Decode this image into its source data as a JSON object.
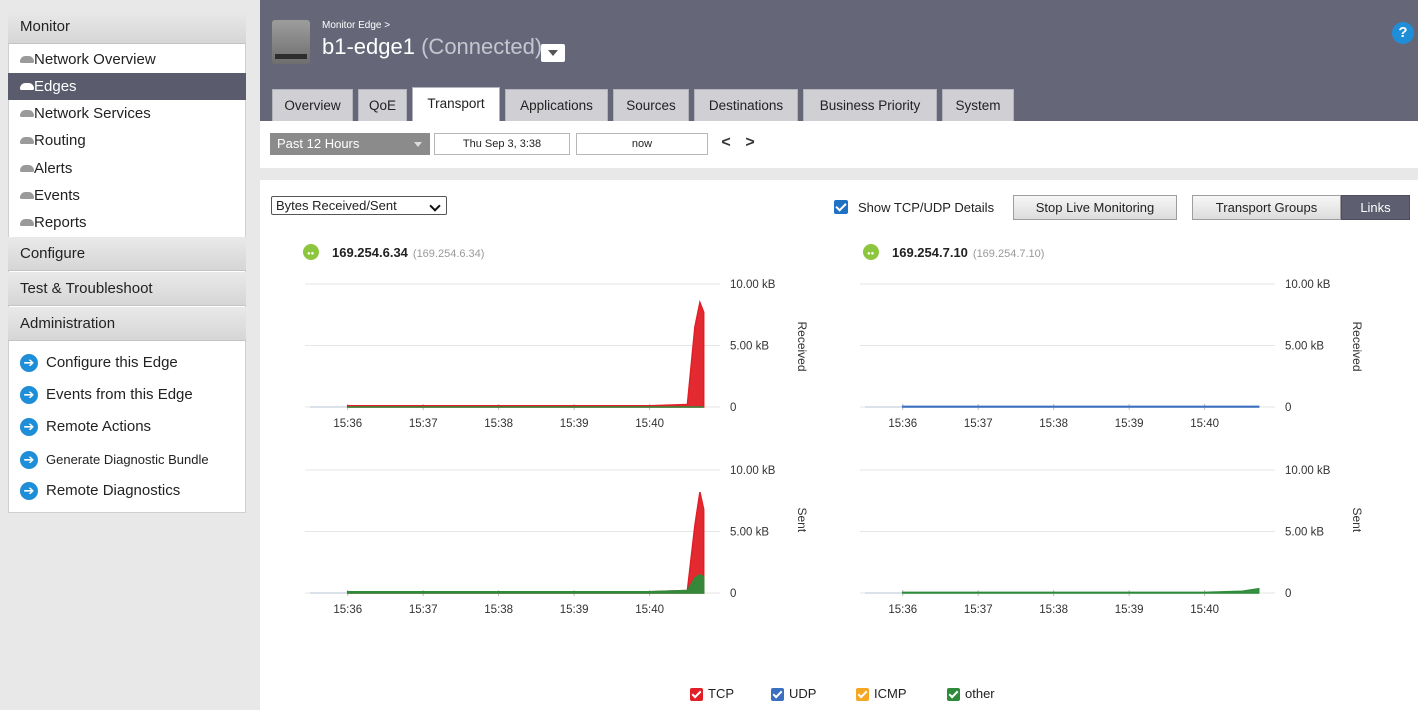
{
  "sidebar": {
    "sections": {
      "monitor": "Monitor",
      "configure": "Configure",
      "test": "Test & Troubleshoot",
      "administration": "Administration"
    },
    "monitor_items": [
      {
        "label": "Network Overview",
        "active": false
      },
      {
        "label": "Edges",
        "active": true
      },
      {
        "label": "Network Services",
        "active": false
      },
      {
        "label": "Routing",
        "active": false
      },
      {
        "label": "Alerts",
        "active": false
      },
      {
        "label": "Events",
        "active": false
      },
      {
        "label": "Reports",
        "active": false
      }
    ],
    "admin_actions": [
      "Configure this Edge",
      "Events from this Edge",
      "Remote Actions",
      "Generate Diagnostic Bundle",
      "Remote Diagnostics"
    ]
  },
  "header": {
    "breadcrumb": "Monitor Edge >",
    "edge_name": "b1-edge1",
    "status": "(Connected)",
    "help": "?"
  },
  "tabs": [
    {
      "label": "Overview",
      "active": false
    },
    {
      "label": "QoE",
      "active": false
    },
    {
      "label": "Transport",
      "active": true
    },
    {
      "label": "Applications",
      "active": false
    },
    {
      "label": "Sources",
      "active": false
    },
    {
      "label": "Destinations",
      "active": false
    },
    {
      "label": "Business Priority",
      "active": false
    },
    {
      "label": "System",
      "active": false
    }
  ],
  "timebar": {
    "range": "Past 12 Hours",
    "start": "Thu Sep 3, 3:38",
    "end": "now",
    "prev": "<",
    "next": ">"
  },
  "controls": {
    "metric": "Bytes Received/Sent",
    "show_tcp_udp_label": "Show TCP/UDP Details",
    "show_tcp_udp_checked": true,
    "stop_live_label": "Stop Live Monitoring",
    "transport_groups_label": "Transport Groups",
    "links_label": "Links"
  },
  "links": [
    {
      "ip": "169.254.6.34",
      "ip_paren": "(169.254.6.34)"
    },
    {
      "ip": "169.254.7.10",
      "ip_paren": "(169.254.7.10)"
    }
  ],
  "colors": {
    "tcp": "#e21f26",
    "udp": "#3b6fbf",
    "icmp": "#f5a623",
    "other": "#2e8b3a",
    "link_icon": "#8cc63f",
    "accent_blue": "#1f8ed8"
  },
  "legend": [
    "TCP",
    "UDP",
    "ICMP",
    "other"
  ],
  "chart_data": [
    {
      "type": "area",
      "link": "169.254.6.34",
      "panel": "Received",
      "x": [
        "15:36",
        "15:37",
        "15:38",
        "15:39",
        "15:40",
        "15:40:30",
        "15:40:36",
        "15:40:40",
        "15:40:43"
      ],
      "series": [
        {
          "name": "TCP",
          "values": [
            0.1,
            0.1,
            0.1,
            0.1,
            0.1,
            0.2,
            6.5,
            8.5,
            7.7
          ]
        },
        {
          "name": "other",
          "values": [
            0,
            0,
            0,
            0,
            0,
            0,
            0,
            0,
            0
          ]
        }
      ],
      "xticks": [
        "15:36",
        "15:37",
        "15:38",
        "15:39",
        "15:40"
      ],
      "yticks": [
        "0",
        "5.00 kB",
        "10.00 kB"
      ],
      "ylim": [
        0,
        10
      ],
      "ylabel": "Received"
    },
    {
      "type": "area",
      "link": "169.254.6.34",
      "panel": "Sent",
      "x": [
        "15:36",
        "15:37",
        "15:38",
        "15:39",
        "15:40",
        "15:40:30",
        "15:40:36",
        "15:40:40",
        "15:40:43"
      ],
      "series": [
        {
          "name": "TCP",
          "values": [
            0.1,
            0.1,
            0.1,
            0.1,
            0.1,
            0.2,
            5.5,
            8.2,
            6.8
          ]
        },
        {
          "name": "other",
          "values": [
            0.1,
            0.1,
            0.1,
            0.1,
            0.1,
            0.2,
            1.2,
            1.5,
            1.3
          ]
        }
      ],
      "xticks": [
        "15:36",
        "15:37",
        "15:38",
        "15:39",
        "15:40"
      ],
      "yticks": [
        "0",
        "5.00 kB",
        "10.00 kB"
      ],
      "ylim": [
        0,
        10
      ],
      "ylabel": "Sent"
    },
    {
      "type": "area",
      "link": "169.254.7.10",
      "panel": "Received",
      "x": [
        "15:36",
        "15:37",
        "15:38",
        "15:39",
        "15:40",
        "15:40:43"
      ],
      "series": [
        {
          "name": "UDP",
          "values": [
            0.05,
            0.05,
            0.05,
            0.05,
            0.05,
            0.05
          ]
        }
      ],
      "xticks": [
        "15:36",
        "15:37",
        "15:38",
        "15:39",
        "15:40"
      ],
      "yticks": [
        "0",
        "5.00 kB",
        "10.00 kB"
      ],
      "ylim": [
        0,
        10
      ],
      "ylabel": "Received"
    },
    {
      "type": "area",
      "link": "169.254.7.10",
      "panel": "Sent",
      "x": [
        "15:36",
        "15:37",
        "15:38",
        "15:39",
        "15:40",
        "15:40:30",
        "15:40:43"
      ],
      "series": [
        {
          "name": "other",
          "values": [
            0.05,
            0.05,
            0.05,
            0.05,
            0.05,
            0.15,
            0.35
          ]
        }
      ],
      "xticks": [
        "15:36",
        "15:37",
        "15:38",
        "15:39",
        "15:40"
      ],
      "yticks": [
        "0",
        "5.00 kB",
        "10.00 kB"
      ],
      "ylim": [
        0,
        10
      ],
      "ylabel": "Sent"
    }
  ]
}
